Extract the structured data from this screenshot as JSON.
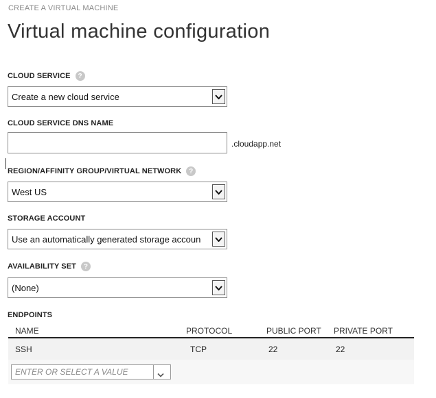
{
  "wizard": {
    "title": "CREATE A VIRTUAL MACHINE"
  },
  "page": {
    "title": "Virtual machine configuration"
  },
  "cloud_service": {
    "label": "CLOUD SERVICE",
    "help": "?",
    "selected": "Create a new cloud service"
  },
  "dns_name": {
    "label": "CLOUD SERVICE DNS NAME",
    "value": "",
    "suffix": ".cloudapp.net"
  },
  "region": {
    "label": "REGION/AFFINITY GROUP/VIRTUAL NETWORK",
    "help": "?",
    "selected": "West US"
  },
  "storage": {
    "label": "STORAGE ACCOUNT",
    "selected": "Use an automatically generated storage accoun"
  },
  "availability": {
    "label": "AVAILABILITY SET",
    "help": "?",
    "selected": "(None)"
  },
  "endpoints": {
    "label": "ENDPOINTS",
    "columns": [
      "NAME",
      "PROTOCOL",
      "PUBLIC PORT",
      "PRIVATE PORT"
    ],
    "rows": [
      {
        "name": "SSH",
        "protocol": "TCP",
        "public_port": "22",
        "private_port": "22"
      }
    ],
    "new_entry_placeholder": "ENTER OR SELECT A VALUE"
  },
  "colors": {
    "row_bg": "#f2f2f2",
    "header_line": "#222222",
    "help_icon": "#c8c8c8"
  },
  "icons": [
    "help-icon",
    "dropdown-arrow-icon",
    "chevron-down-icon"
  ]
}
